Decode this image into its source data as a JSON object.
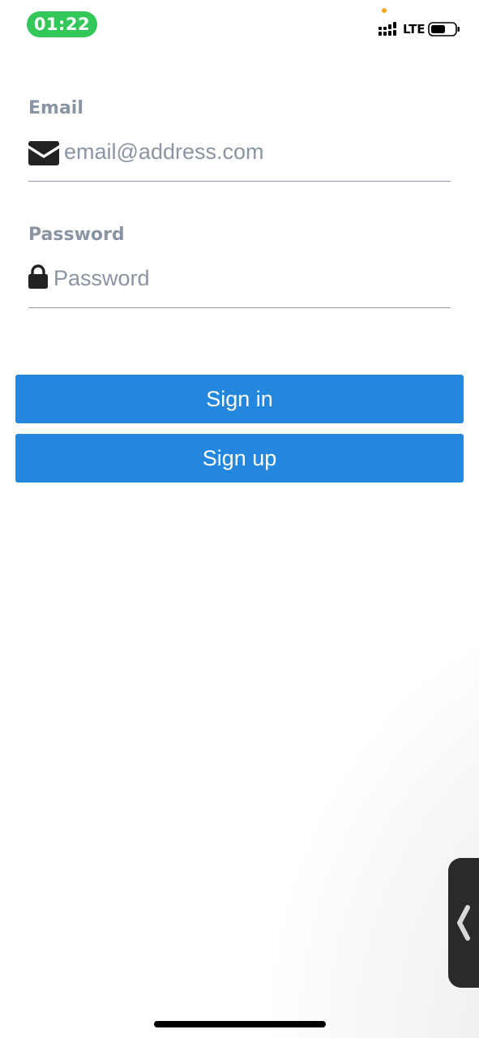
{
  "status_bar": {
    "time": "01:22",
    "network": "LTE",
    "signal_icon": "signal-bars-icon",
    "battery_icon": "battery-icon",
    "time_pill_color": "#34c759",
    "privacy_dot_color": "#f5a623"
  },
  "form": {
    "email": {
      "label": "Email",
      "placeholder": "email@address.com",
      "value": "",
      "icon": "envelope-icon"
    },
    "password": {
      "label": "Password",
      "placeholder": "Password",
      "value": "",
      "icon": "lock-icon"
    }
  },
  "actions": {
    "sign_in_label": "Sign in",
    "sign_up_label": "Sign up",
    "button_color": "#2287dd"
  },
  "side_handle": {
    "icon": "chevron-left-icon"
  }
}
